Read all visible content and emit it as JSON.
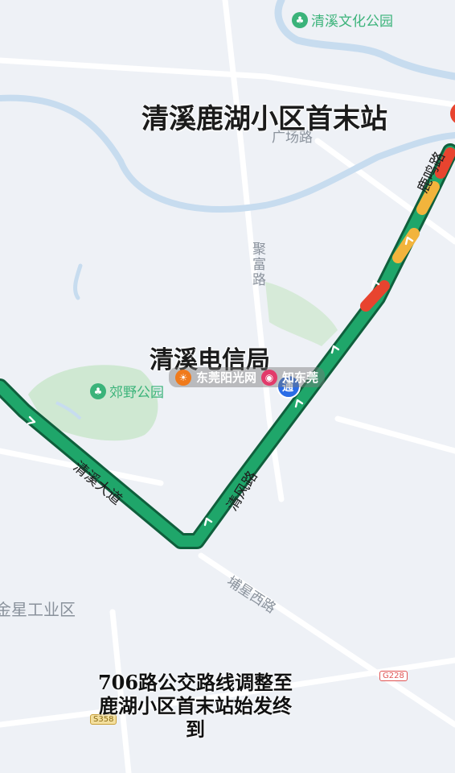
{
  "map": {
    "route_color": "#1fa66a",
    "congestion_colors": {
      "slow": "#f2b43c",
      "jam": "#e8442f"
    },
    "water_color": "#c7dcef",
    "park_color": "#cfe8d2"
  },
  "pois": [
    {
      "name": "清溪文化公园",
      "icon": "park-icon"
    },
    {
      "name": "郊野公园",
      "icon": "park-icon"
    }
  ],
  "roads": {
    "guangchang": "广场路",
    "jufu": "聚富路",
    "luming": "鹿鸣路",
    "qingfeng": "清风路",
    "qingxi_avenue": "清溪大道",
    "puxing_west": "埔星西路",
    "industrial": "金星工业区"
  },
  "badges": {
    "g228": "G228",
    "s358": "S358"
  },
  "overlay": {
    "terminal_title": "清溪鹿湖小区首末站",
    "telecom_title": "清溪电信局",
    "bus_stop_glyph": "通"
  },
  "watermark": {
    "left_text": "东莞阳光网",
    "right_text": "知东莞"
  },
  "caption": {
    "line1": "706路公交路线调整至",
    "line2": "鹿湖小区首末站始发终",
    "line3": "到"
  }
}
